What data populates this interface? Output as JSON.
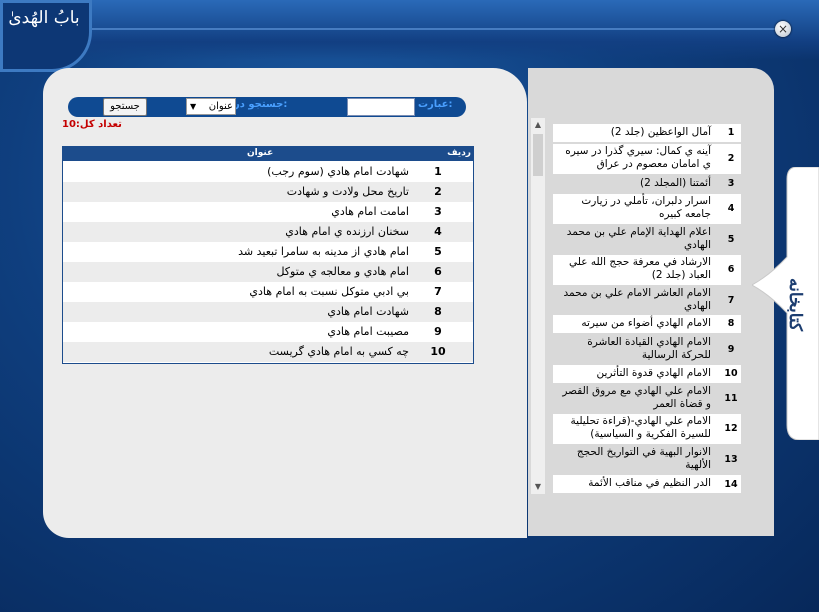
{
  "app": {
    "logo_text": "بابُ الهُدیٰ",
    "close_symbol": "×"
  },
  "search": {
    "phrase_label": "عبارت:",
    "field_label": "جستجو در:",
    "field_selected": "عنوان",
    "button_label": "جستجو",
    "input_value": "",
    "count_label": "تعداد کل:10"
  },
  "table": {
    "headers": {
      "radif": "رديف",
      "title": "عنوان"
    },
    "rows": [
      {
        "num": "1",
        "title": "شهادت امام هادي (سوم رجب)"
      },
      {
        "num": "2",
        "title": "تاريخ محل ولادت و شهادت"
      },
      {
        "num": "3",
        "title": "امامت امام هادي"
      },
      {
        "num": "4",
        "title": "سخنان ارزنده ي امام هادي"
      },
      {
        "num": "5",
        "title": "امام هادي از مدينه به سامرا تبعيد شد"
      },
      {
        "num": "6",
        "title": "امام هادي و معالجه ي متوكل"
      },
      {
        "num": "7",
        "title": "بي ادبي متوكل نسبت به امام هادي"
      },
      {
        "num": "8",
        "title": "شهادت امام هادي"
      },
      {
        "num": "9",
        "title": "مصيبت امام هادي"
      },
      {
        "num": "10",
        "title": "چه كسي به امام هادي گريست"
      }
    ]
  },
  "books": [
    {
      "num": "1",
      "title": "آمال الواعظين (جلد 2)"
    },
    {
      "num": "2",
      "title": "آينه ي كمال: سيري گذرا در سيره ي امامان معصوم در عراق"
    },
    {
      "num": "3",
      "title": "أئمتنا (المجلد 2)"
    },
    {
      "num": "4",
      "title": "اسرار دلبران، تأملي در زيارت جامعه كبيره"
    },
    {
      "num": "5",
      "title": "اعلام الهداية الإمام علي بن محمد الهادي"
    },
    {
      "num": "6",
      "title": "الارشاد في معرفة حجج الله علي العباد (جلد 2)"
    },
    {
      "num": "7",
      "title": "الامام العاشر الامام علي بن محمد الهادي"
    },
    {
      "num": "8",
      "title": "الامام الهادي أضواء من سيرته"
    },
    {
      "num": "9",
      "title": "الامام الهادي القيادة العاشرة للحركة الرسالية"
    },
    {
      "num": "10",
      "title": "الامام الهادي قدوة التأثرين"
    },
    {
      "num": "11",
      "title": "الامام علي الهادي مع مروق القصر و قضاة العمر"
    },
    {
      "num": "12",
      "title": "الامام علي الهادي-(قراءة تحليلية للسيرة الفكرية و السياسية)"
    },
    {
      "num": "13",
      "title": "الانوار البهية في التواريخ الحجج الألهية"
    },
    {
      "num": "14",
      "title": "الدر النظيم في مناقب الأئمة"
    }
  ],
  "side_tab": {
    "label": "كتابخانه"
  }
}
